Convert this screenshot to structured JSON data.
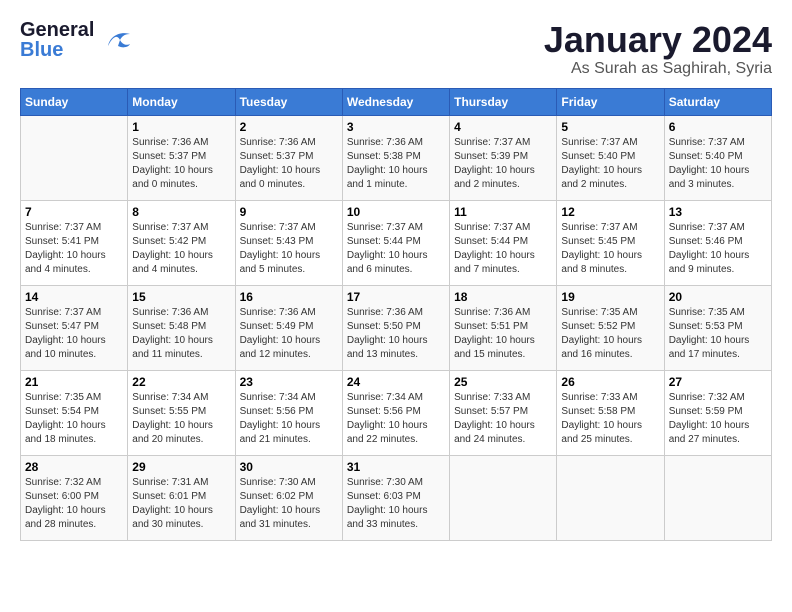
{
  "header": {
    "logo_general": "General",
    "logo_blue": "Blue",
    "month_title": "January 2024",
    "location": "As Surah as Saghirah, Syria"
  },
  "days_of_week": [
    "Sunday",
    "Monday",
    "Tuesday",
    "Wednesday",
    "Thursday",
    "Friday",
    "Saturday"
  ],
  "weeks": [
    [
      {
        "day": "",
        "info": ""
      },
      {
        "day": "1",
        "info": "Sunrise: 7:36 AM\nSunset: 5:37 PM\nDaylight: 10 hours\nand 0 minutes."
      },
      {
        "day": "2",
        "info": "Sunrise: 7:36 AM\nSunset: 5:37 PM\nDaylight: 10 hours\nand 0 minutes."
      },
      {
        "day": "3",
        "info": "Sunrise: 7:36 AM\nSunset: 5:38 PM\nDaylight: 10 hours\nand 1 minute."
      },
      {
        "day": "4",
        "info": "Sunrise: 7:37 AM\nSunset: 5:39 PM\nDaylight: 10 hours\nand 2 minutes."
      },
      {
        "day": "5",
        "info": "Sunrise: 7:37 AM\nSunset: 5:40 PM\nDaylight: 10 hours\nand 2 minutes."
      },
      {
        "day": "6",
        "info": "Sunrise: 7:37 AM\nSunset: 5:40 PM\nDaylight: 10 hours\nand 3 minutes."
      }
    ],
    [
      {
        "day": "7",
        "info": "Sunrise: 7:37 AM\nSunset: 5:41 PM\nDaylight: 10 hours\nand 4 minutes."
      },
      {
        "day": "8",
        "info": "Sunrise: 7:37 AM\nSunset: 5:42 PM\nDaylight: 10 hours\nand 4 minutes."
      },
      {
        "day": "9",
        "info": "Sunrise: 7:37 AM\nSunset: 5:43 PM\nDaylight: 10 hours\nand 5 minutes."
      },
      {
        "day": "10",
        "info": "Sunrise: 7:37 AM\nSunset: 5:44 PM\nDaylight: 10 hours\nand 6 minutes."
      },
      {
        "day": "11",
        "info": "Sunrise: 7:37 AM\nSunset: 5:44 PM\nDaylight: 10 hours\nand 7 minutes."
      },
      {
        "day": "12",
        "info": "Sunrise: 7:37 AM\nSunset: 5:45 PM\nDaylight: 10 hours\nand 8 minutes."
      },
      {
        "day": "13",
        "info": "Sunrise: 7:37 AM\nSunset: 5:46 PM\nDaylight: 10 hours\nand 9 minutes."
      }
    ],
    [
      {
        "day": "14",
        "info": "Sunrise: 7:37 AM\nSunset: 5:47 PM\nDaylight: 10 hours\nand 10 minutes."
      },
      {
        "day": "15",
        "info": "Sunrise: 7:36 AM\nSunset: 5:48 PM\nDaylight: 10 hours\nand 11 minutes."
      },
      {
        "day": "16",
        "info": "Sunrise: 7:36 AM\nSunset: 5:49 PM\nDaylight: 10 hours\nand 12 minutes."
      },
      {
        "day": "17",
        "info": "Sunrise: 7:36 AM\nSunset: 5:50 PM\nDaylight: 10 hours\nand 13 minutes."
      },
      {
        "day": "18",
        "info": "Sunrise: 7:36 AM\nSunset: 5:51 PM\nDaylight: 10 hours\nand 15 minutes."
      },
      {
        "day": "19",
        "info": "Sunrise: 7:35 AM\nSunset: 5:52 PM\nDaylight: 10 hours\nand 16 minutes."
      },
      {
        "day": "20",
        "info": "Sunrise: 7:35 AM\nSunset: 5:53 PM\nDaylight: 10 hours\nand 17 minutes."
      }
    ],
    [
      {
        "day": "21",
        "info": "Sunrise: 7:35 AM\nSunset: 5:54 PM\nDaylight: 10 hours\nand 18 minutes."
      },
      {
        "day": "22",
        "info": "Sunrise: 7:34 AM\nSunset: 5:55 PM\nDaylight: 10 hours\nand 20 minutes."
      },
      {
        "day": "23",
        "info": "Sunrise: 7:34 AM\nSunset: 5:56 PM\nDaylight: 10 hours\nand 21 minutes."
      },
      {
        "day": "24",
        "info": "Sunrise: 7:34 AM\nSunset: 5:56 PM\nDaylight: 10 hours\nand 22 minutes."
      },
      {
        "day": "25",
        "info": "Sunrise: 7:33 AM\nSunset: 5:57 PM\nDaylight: 10 hours\nand 24 minutes."
      },
      {
        "day": "26",
        "info": "Sunrise: 7:33 AM\nSunset: 5:58 PM\nDaylight: 10 hours\nand 25 minutes."
      },
      {
        "day": "27",
        "info": "Sunrise: 7:32 AM\nSunset: 5:59 PM\nDaylight: 10 hours\nand 27 minutes."
      }
    ],
    [
      {
        "day": "28",
        "info": "Sunrise: 7:32 AM\nSunset: 6:00 PM\nDaylight: 10 hours\nand 28 minutes."
      },
      {
        "day": "29",
        "info": "Sunrise: 7:31 AM\nSunset: 6:01 PM\nDaylight: 10 hours\nand 30 minutes."
      },
      {
        "day": "30",
        "info": "Sunrise: 7:30 AM\nSunset: 6:02 PM\nDaylight: 10 hours\nand 31 minutes."
      },
      {
        "day": "31",
        "info": "Sunrise: 7:30 AM\nSunset: 6:03 PM\nDaylight: 10 hours\nand 33 minutes."
      },
      {
        "day": "",
        "info": ""
      },
      {
        "day": "",
        "info": ""
      },
      {
        "day": "",
        "info": ""
      }
    ]
  ]
}
